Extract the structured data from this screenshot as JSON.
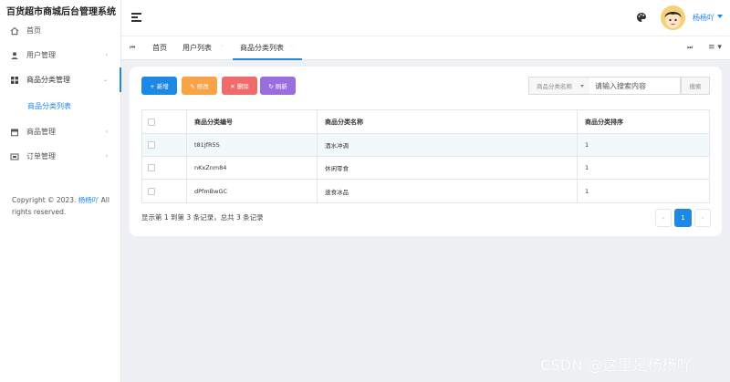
{
  "app": {
    "title": "百货超市商城后台管理系统"
  },
  "sidebar": {
    "items": [
      {
        "label": "首页",
        "icon": "home-icon"
      },
      {
        "label": "用户管理",
        "icon": "user-icon",
        "arrow": "‹"
      },
      {
        "label": "商品分类管理",
        "icon": "grid-icon",
        "arrow": "⌄"
      },
      {
        "label": "商品管理",
        "icon": "store-icon",
        "arrow": "‹"
      },
      {
        "label": "订单管理",
        "icon": "order-icon",
        "arrow": "‹"
      }
    ],
    "sub_items": [
      {
        "label": "商品分类列表"
      }
    ],
    "copyright_prefix": "Copyright © 2023.",
    "copyright_author": "杨杨吖",
    "copyright_suffix": "All rights reserved."
  },
  "header": {
    "username": "杨杨吖"
  },
  "tabs": {
    "prev": "⏮",
    "next": "⏭",
    "menu": "≡ ▾",
    "items": [
      {
        "label": "首页"
      },
      {
        "label": "用户列表"
      },
      {
        "label": "商品分类列表",
        "active": true
      }
    ],
    "close_glyph": "·"
  },
  "toolbar": {
    "add": "+ 新增",
    "edit": "✎ 修改",
    "delete": "✕ 删除",
    "refresh": "↻ 刷新"
  },
  "search": {
    "field_label": "商品分类名称",
    "placeholder": "请输入搜索内容",
    "button": "搜索"
  },
  "table": {
    "columns": [
      "",
      "商品分类编号",
      "商品分类名称",
      "商品分类排序"
    ],
    "rows": [
      {
        "id": "t81JfR5S",
        "name": "酒水冲调",
        "sort": "1"
      },
      {
        "id": "nKxZnm84",
        "name": "休闲零食",
        "sort": "1"
      },
      {
        "id": "dPfmBwGC",
        "name": "速食冰品",
        "sort": "1"
      }
    ]
  },
  "pagination": {
    "info": "显示第 1 到第 3 条记录，总共 3 条记录",
    "prev": "‹",
    "current": "1",
    "next": "›"
  },
  "watermark": "CSDN @这里是杨杨吖",
  "colors": {
    "primary": "#1e88e5",
    "add": "#1e88e5",
    "edit": "#f8a348",
    "delete": "#f06b6b",
    "refresh": "#9b6ee0"
  }
}
